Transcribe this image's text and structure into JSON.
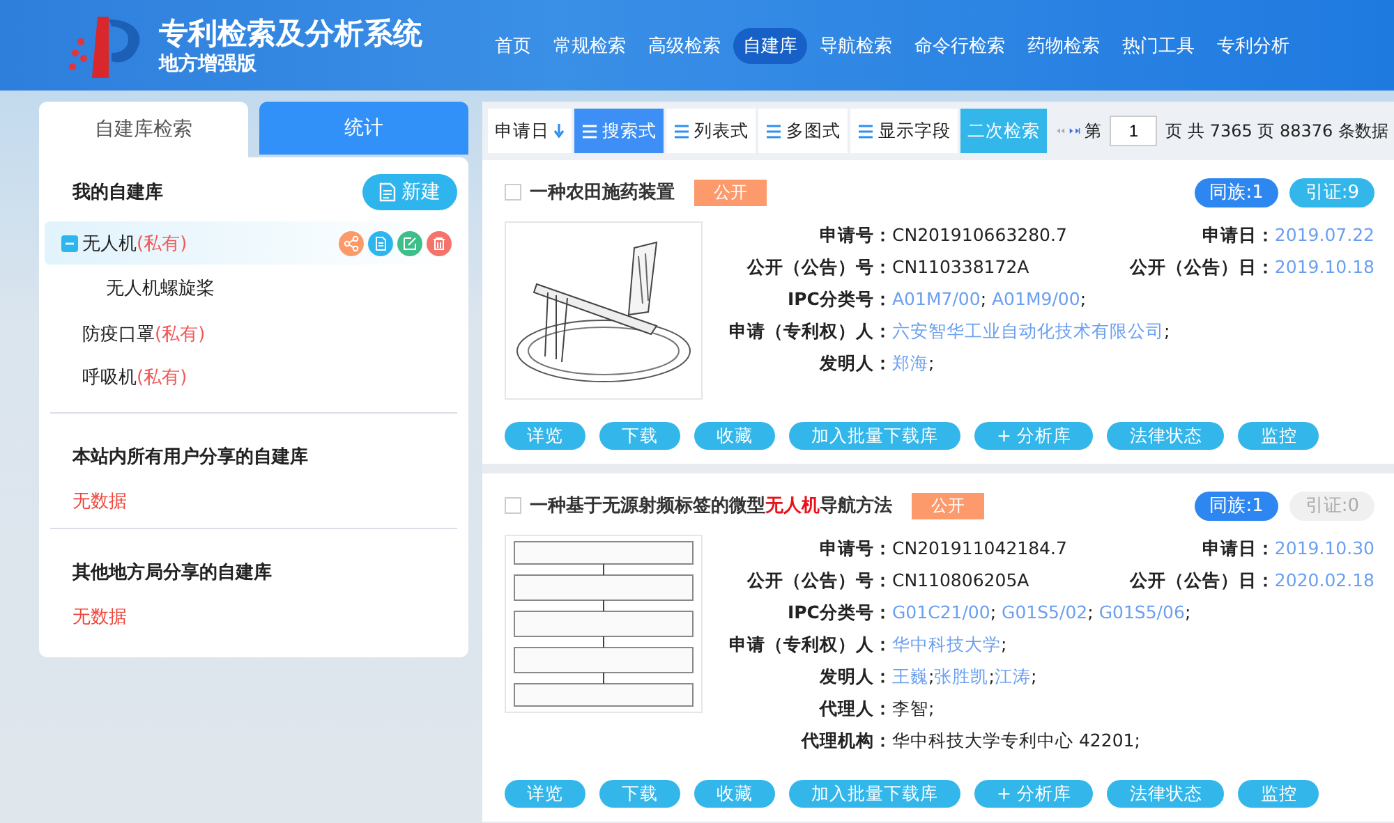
{
  "header": {
    "title": "专利检索及分析系统",
    "subtitle": "地方增强版",
    "nav": [
      {
        "label": "首页",
        "selected": false
      },
      {
        "label": "常规检索",
        "selected": false
      },
      {
        "label": "高级检索",
        "selected": false
      },
      {
        "label": "自建库",
        "selected": true
      },
      {
        "label": "导航检索",
        "selected": false
      },
      {
        "label": "命令行检索",
        "selected": false
      },
      {
        "label": "药物检索",
        "selected": false
      },
      {
        "label": "热门工具",
        "selected": false
      },
      {
        "label": "专利分析",
        "selected": false
      }
    ]
  },
  "sidebar": {
    "tabs": [
      {
        "label": "自建库检索",
        "selected": true
      },
      {
        "label": "统计",
        "selected": false
      }
    ],
    "my_library": {
      "title": "我的自建库",
      "new_button": "新建",
      "items": [
        {
          "name": "无人机",
          "tag": "(私有)",
          "selected": true,
          "expanded": true,
          "children": [
            {
              "name": "无人机螺旋桨",
              "selected": false
            }
          ]
        },
        {
          "name": "防疫口罩",
          "tag": "(私有)",
          "selected": false
        },
        {
          "name": "呼吸机",
          "tag": "(私有)",
          "selected": false
        }
      ]
    },
    "sections": [
      {
        "title": "本站内所有用户分享的自建库",
        "empty": "无数据"
      },
      {
        "title": "其他地方局分享的自建库",
        "empty": "无数据"
      }
    ]
  },
  "toolbar": {
    "sort": "申请日",
    "views": [
      {
        "label": "搜索式",
        "selected": true
      },
      {
        "label": "列表式",
        "selected": false
      },
      {
        "label": "多图式",
        "selected": false
      },
      {
        "label": "显示字段",
        "selected": false
      }
    ],
    "secondary_search": "二次检索",
    "page_prefix": "第",
    "page": "1",
    "page_info": "页 共 7365 页 88376 条数据"
  },
  "results": [
    {
      "title": [
        {
          "text": "一种农田施药装置",
          "highlight": false
        }
      ],
      "checked": false,
      "status": "公开",
      "family": {
        "label": "同族:1",
        "disabled": false
      },
      "citation": {
        "label": "引证:9",
        "disabled": false
      },
      "rows": [
        {
          "label": "申请号：",
          "parts": [
            {
              "text": "CN201910663280.7",
              "link": false
            }
          ],
          "right": {
            "label": "申请日：",
            "parts": [
              {
                "text": "2019.07.22",
                "link": true
              }
            ]
          }
        },
        {
          "label": "公开（公告）号：",
          "parts": [
            {
              "text": "CN110338172A",
              "link": false
            }
          ],
          "right": {
            "label": "公开（公告）日：",
            "parts": [
              {
                "text": "2019.10.18",
                "link": true
              }
            ]
          }
        },
        {
          "label": "IPC分类号：",
          "parts": [
            {
              "text": "A01M7/00",
              "link": true
            },
            {
              "text": "; ",
              "link": false
            },
            {
              "text": "A01M9/00",
              "link": true
            },
            {
              "text": ";",
              "link": false
            }
          ]
        },
        {
          "label": "申请（专利权）人：",
          "parts": [
            {
              "text": "六安智华工业自动化技术有限公司",
              "link": true
            },
            {
              "text": ";",
              "link": false
            }
          ]
        },
        {
          "label": "发明人：",
          "parts": [
            {
              "text": "郑海",
              "link": true
            },
            {
              "text": ";",
              "link": false
            }
          ]
        }
      ],
      "picture": {
        "kind": "picture"
      },
      "actions": [
        "详览",
        "下载",
        "收藏",
        "加入批量下载库",
        "+ 分析库",
        "法律状态",
        "监控"
      ]
    },
    {
      "title": [
        {
          "text": "一种基于无源射频标签的微型",
          "highlight": false
        },
        {
          "text": "无人机",
          "highlight": true
        },
        {
          "text": "导航方法",
          "highlight": false
        }
      ],
      "checked": false,
      "status": "公开",
      "family": {
        "label": "同族:1",
        "disabled": false
      },
      "citation": {
        "label": "引证:0",
        "disabled": true
      },
      "rows": [
        {
          "label": "申请号：",
          "parts": [
            {
              "text": "CN201911042184.7",
              "link": false
            }
          ],
          "right": {
            "label": "申请日：",
            "parts": [
              {
                "text": "2019.10.30",
                "link": true
              }
            ]
          }
        },
        {
          "label": "公开（公告）号：",
          "parts": [
            {
              "text": "CN110806205A",
              "link": false
            }
          ],
          "right": {
            "label": "公开（公告）日：",
            "parts": [
              {
                "text": "2020.02.18",
                "link": true
              }
            ]
          }
        },
        {
          "label": "IPC分类号：",
          "parts": [
            {
              "text": "G01C21/00",
              "link": true
            },
            {
              "text": "; ",
              "link": false
            },
            {
              "text": "G01S5/02",
              "link": true
            },
            {
              "text": "; ",
              "link": false
            },
            {
              "text": "G01S5/06",
              "link": true
            },
            {
              "text": ";",
              "link": false
            }
          ]
        },
        {
          "label": "申请（专利权）人：",
          "parts": [
            {
              "text": "华中科技大学",
              "link": true
            },
            {
              "text": ";",
              "link": false
            }
          ]
        },
        {
          "label": "发明人：",
          "parts": [
            {
              "text": "王巍",
              "link": true
            },
            {
              "text": ";",
              "link": false
            },
            {
              "text": "张胜凯",
              "link": true
            },
            {
              "text": ";",
              "link": false
            },
            {
              "text": "江涛",
              "link": true
            },
            {
              "text": ";",
              "link": false
            }
          ]
        },
        {
          "label": "代理人：",
          "parts": [
            {
              "text": "李智;",
              "link": false
            }
          ]
        },
        {
          "label": "代理机构：",
          "parts": [
            {
              "text": "华中科技大学专利中心 42201;",
              "link": false
            }
          ]
        }
      ],
      "picture": {
        "kind": "picture"
      },
      "actions": [
        "详览",
        "下载",
        "收藏",
        "加入批量下载库",
        "+ 分析库",
        "法律状态",
        "监控"
      ]
    }
  ]
}
